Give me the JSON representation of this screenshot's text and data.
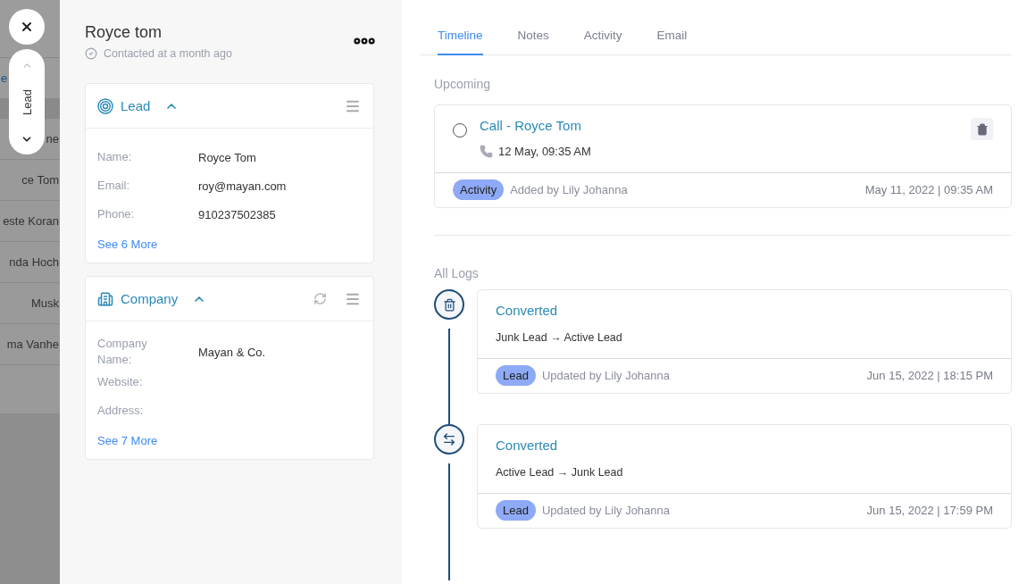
{
  "background_list": {
    "link": "e",
    "rows": [
      "ne",
      "ce Tom",
      "este Koran",
      "nda Hoch",
      "Musk",
      "ma Vanhe"
    ]
  },
  "stage_switcher": {
    "label": "Lead"
  },
  "contact": {
    "name": "Royce tom",
    "status": "Contacted at a month ago"
  },
  "cards": [
    {
      "kind": "lead",
      "title": "Lead",
      "expanded": true,
      "refreshable": false,
      "fields": [
        {
          "label": "Name:",
          "value": "Royce Tom"
        },
        {
          "label": "Email:",
          "value": "roy@mayan.com"
        },
        {
          "label": "Phone:",
          "value": "910237502385"
        }
      ],
      "more": "See 6 More"
    },
    {
      "kind": "company",
      "title": "Company",
      "expanded": true,
      "refreshable": true,
      "fields": [
        {
          "label": "Company Name:",
          "value": "Mayan & Co."
        },
        {
          "label": "Website:"
        },
        {
          "label": "Address:"
        }
      ],
      "more": "See 7 More"
    }
  ],
  "tabs": [
    {
      "label": "Timeline",
      "selected": true
    },
    {
      "label": "Notes",
      "selected": false
    },
    {
      "label": "Activity",
      "selected": false
    },
    {
      "label": "Email",
      "selected": false
    }
  ],
  "upcoming": {
    "heading": "Upcoming",
    "items": [
      {
        "title": "Call - Royce Tom",
        "done": false,
        "time": "12 May, 09:35 AM",
        "tag": "Activity",
        "by": "Added by Lily Johanna",
        "date": "May 11, 2022 | 09:35 AM"
      }
    ]
  },
  "logs": {
    "heading": "All Logs",
    "items": [
      {
        "kind": "trash",
        "title": "Converted",
        "change": "Junk Lead → Active Lead",
        "tag": "Lead",
        "by": "Updated by Lily Johanna",
        "date": "Jun 15, 2022 | 18:15 PM"
      },
      {
        "kind": "swap",
        "title": "Converted",
        "change": "Active Lead → Junk Lead",
        "tag": "Lead",
        "by": "Updated by Lily Johanna",
        "date": "Jun 15, 2022 | 17:59 PM"
      }
    ]
  }
}
